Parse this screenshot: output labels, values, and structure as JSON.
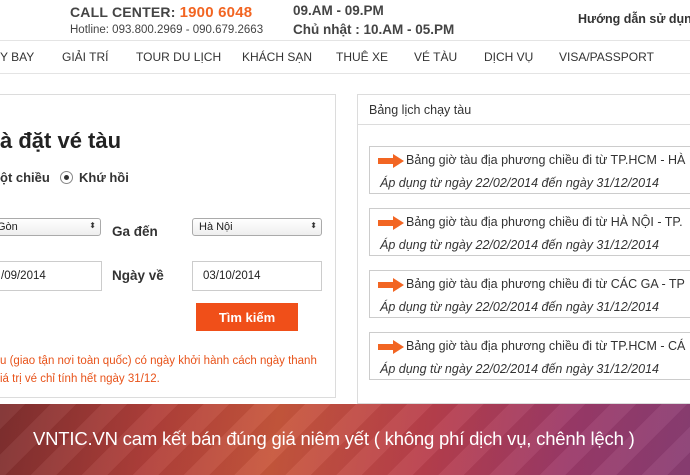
{
  "header": {
    "call_center_label": "CALL CENTER:",
    "call_center_number": "1900 6048",
    "hotline": "Hotline: 093.800.2969 - 090.679.2663",
    "hours_weekday": "09.AM - 09.PM",
    "hours_sunday": "Chủ nhật : 10.AM - 05.PM",
    "guide_link": "Hướng dẫn sử dụn"
  },
  "nav": {
    "items": [
      {
        "label": "Y BAY"
      },
      {
        "label": "GIẢI TRÍ"
      },
      {
        "label": "TOUR DU LỊCH"
      },
      {
        "label": "KHÁCH SẠN"
      },
      {
        "label": "THUÊ XE"
      },
      {
        "label": "VÉ TÀU"
      },
      {
        "label": "DỊCH VỤ"
      },
      {
        "label": "VISA/PASSPORT"
      }
    ]
  },
  "booking": {
    "title": "à đặt vé tàu",
    "one_way": "ột chiều",
    "round_trip": "Khứ hồi",
    "from_value": "Gòn",
    "to_label": "Ga đến",
    "to_value": "Hà Nội",
    "depart_value": "/09/2014",
    "return_label": "Ngày về",
    "return_value": "03/10/2014",
    "search_button": "Tìm kiếm",
    "note_line1": "u (giao tận nơi toàn quốc) có ngày khởi hành cách ngày thanh",
    "note_line2": "iá trị vé chỉ tính hết ngày 31/12."
  },
  "schedule": {
    "title": "Bảng lịch chạy tàu",
    "items": [
      {
        "link": "Bảng giờ tàu địa phương chiều đi từ TP.HCM - HÀ",
        "date": "Áp dụng từ ngày 22/02/2014 đến ngày 31/12/2014"
      },
      {
        "link": "Bảng giờ tàu địa phương chiều đi từ HÀ NỘI - TP.",
        "date": "Áp dụng từ ngày 22/02/2014 đến ngày 31/12/2014"
      },
      {
        "link": "Bảng giờ tàu địa phương chiều đi từ CÁC GA - TP",
        "date": "Áp dụng từ ngày 22/02/2014 đến ngày 31/12/2014"
      },
      {
        "link": "Bảng giờ tàu địa phương chiều đi từ TP.HCM - CÁ",
        "date": "Áp dụng từ ngày 22/02/2014 đến ngày 31/12/2014"
      }
    ]
  },
  "banner": {
    "text": "VNTIC.VN cam kết bán đúng giá niêm yết ( không phí dịch vụ, chênh lệch )"
  },
  "icons": {
    "schedule_arrow": "right-arrow-icon",
    "select_arrow": "chevron-updown-icon"
  },
  "colors": {
    "accent": "#f26522",
    "button": "#f04f19",
    "note": "#e8531a"
  }
}
